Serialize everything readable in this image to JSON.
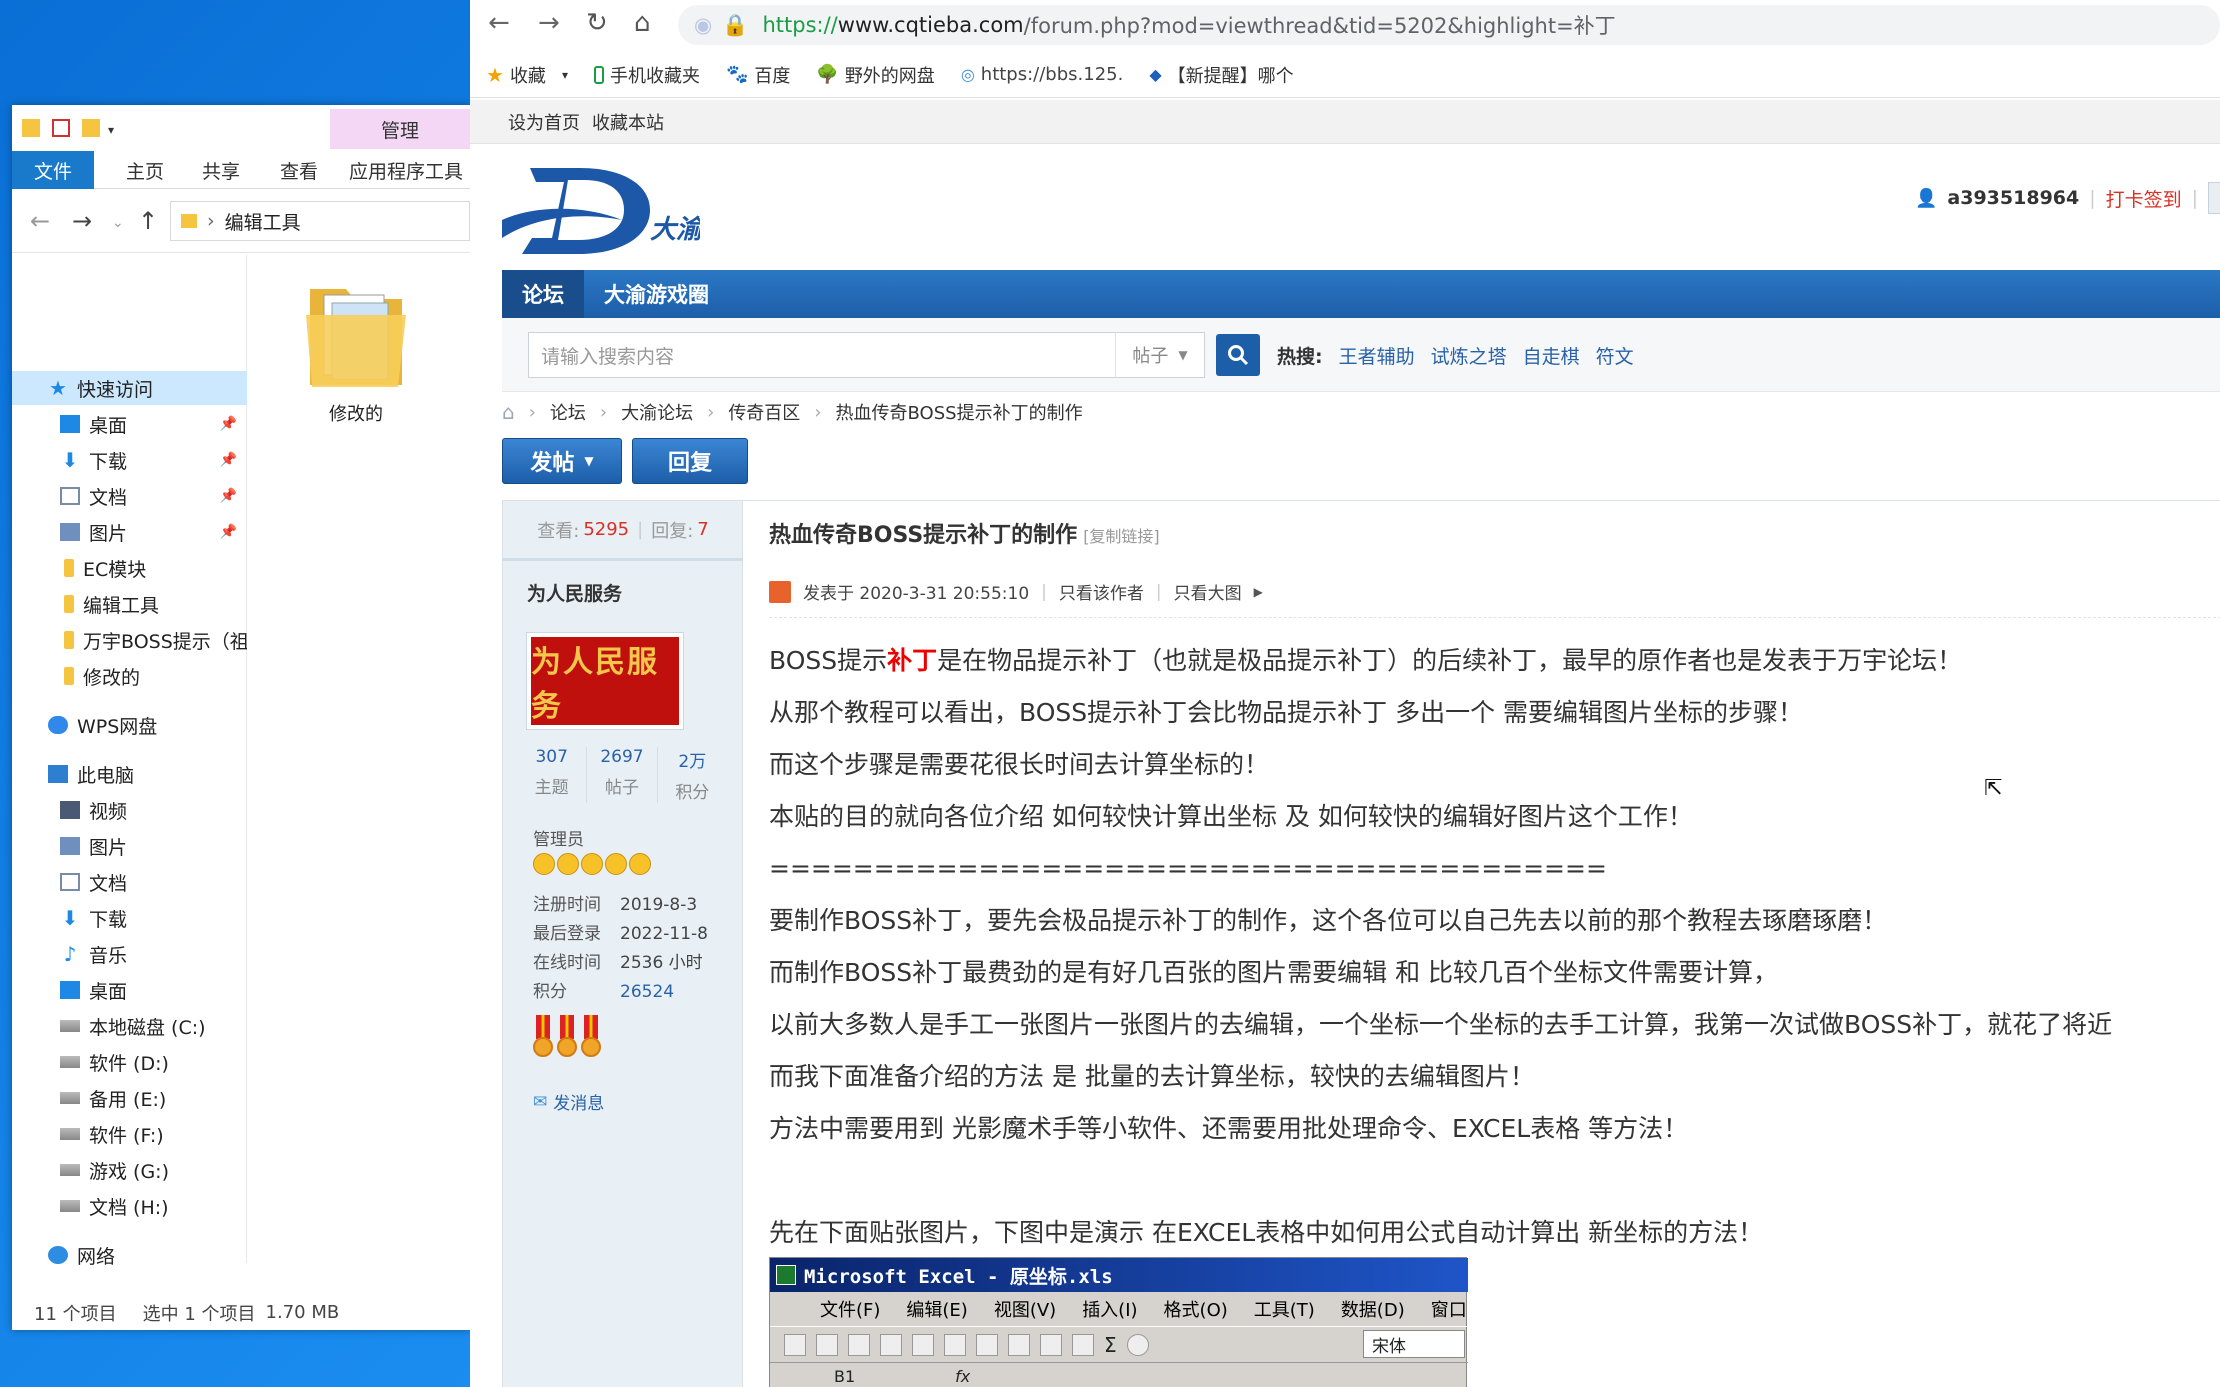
{
  "explorer": {
    "ribbon_context": "管理",
    "tabs": [
      "文件",
      "主页",
      "共享",
      "查看",
      "应用程序工具"
    ],
    "path": "编辑工具",
    "tree": [
      {
        "label": "快速访问",
        "icon": "star-icon"
      },
      {
        "label": "桌面",
        "icon": "desktop-icon",
        "pinned": true
      },
      {
        "label": "下载",
        "icon": "download-icon",
        "pinned": true
      },
      {
        "label": "文档",
        "icon": "document-icon",
        "pinned": true
      },
      {
        "label": "图片",
        "icon": "pictures-icon",
        "pinned": true
      },
      {
        "label": "EC模块",
        "icon": "folder-icon"
      },
      {
        "label": "编辑工具",
        "icon": "folder-icon"
      },
      {
        "label": "万宇BOSS提示（祖",
        "icon": "folder-icon"
      },
      {
        "label": "修改的",
        "icon": "folder-icon"
      },
      {
        "label": "WPS网盘",
        "icon": "cloud-icon"
      },
      {
        "label": "此电脑",
        "icon": "computer-icon"
      },
      {
        "label": "视频",
        "icon": "video-icon"
      },
      {
        "label": "图片",
        "icon": "pictures-icon"
      },
      {
        "label": "文档",
        "icon": "document-icon"
      },
      {
        "label": "下载",
        "icon": "download-icon"
      },
      {
        "label": "音乐",
        "icon": "music-icon"
      },
      {
        "label": "桌面",
        "icon": "desktop-icon"
      },
      {
        "label": "本地磁盘 (C:)",
        "icon": "drive-icon"
      },
      {
        "label": "软件 (D:)",
        "icon": "drive-icon"
      },
      {
        "label": "备用 (E:)",
        "icon": "drive-icon"
      },
      {
        "label": "软件 (F:)",
        "icon": "drive-icon"
      },
      {
        "label": "游戏 (G:)",
        "icon": "drive-icon"
      },
      {
        "label": "文档 (H:)",
        "icon": "drive-icon"
      },
      {
        "label": "网络",
        "icon": "network-icon"
      }
    ],
    "folder_item": "修改的",
    "status": {
      "count": "11 个项目",
      "selected": "选中 1 个项目",
      "size": "1.70 MB"
    }
  },
  "browser": {
    "url_scheme": "https://",
    "url_host": "www.cqtieba.com",
    "url_path": "/forum.php?mod=viewthread&tid=5202&highlight=补丁",
    "bookmarks": [
      {
        "label": "收藏",
        "icon": "star-icon",
        "color": "#f4a300"
      },
      {
        "label": "手机收藏夹",
        "icon": "phone-icon",
        "color": "#1a9c46"
      },
      {
        "label": "百度",
        "icon": "baidu-icon",
        "color": "#2932e1"
      },
      {
        "label": "野外的网盘",
        "icon": "tree-icon",
        "color": "#2e8b2e"
      },
      {
        "label": "https://bbs.125.",
        "icon": "eye-icon",
        "color": "#3a8fd8"
      },
      {
        "label": "【新提醒】哪个",
        "icon": "bird-icon",
        "color": "#1e5fbf"
      }
    ]
  },
  "site": {
    "topbar": [
      "设为首页",
      "收藏本站"
    ],
    "logo_text": "大渝",
    "username": "a393518964",
    "checkin": "打卡签到",
    "nav": [
      "论坛",
      "大渝游戏圈"
    ],
    "search_placeholder": "请输入搜索内容",
    "search_type": "帖子",
    "hot_label": "热搜:",
    "hot": [
      "王者辅助",
      "试炼之塔",
      "自走棋",
      "符文"
    ],
    "breadcrumbs": [
      "论坛",
      "大渝论坛",
      "传奇百区",
      "热血传奇BOSS提示补丁的制作"
    ],
    "post_button": "发帖",
    "reply_button": "回复"
  },
  "thread": {
    "views_label": "查看:",
    "views": "5295",
    "replies_label": "回复:",
    "replies": "7",
    "title": "热血传奇BOSS提示补丁的制作",
    "copy_link": "[复制链接]",
    "author": "为人民服务",
    "avatar_text": "为人民服务",
    "user_stats": [
      {
        "value": "307",
        "label": "主题"
      },
      {
        "value": "2697",
        "label": "帖子"
      },
      {
        "value": "2万",
        "label": "积分"
      }
    ],
    "role": "管理员",
    "info": [
      {
        "key": "注册时间",
        "value": "2019-8-3"
      },
      {
        "key": "最后登录",
        "value": "2022-11-8"
      },
      {
        "key": "在线时间",
        "value": "2536 小时"
      },
      {
        "key": "积分",
        "value": "26524"
      }
    ],
    "send_message": "发消息",
    "posted": "发表于 2020-3-31 20:55:10",
    "only_author": "只看该作者",
    "only_images": "只看大图",
    "post_lines": [
      "从那个教程可以看出，BOSS提示补丁会比物品提示补丁 多出一个 需要编辑图片坐标的步骤！",
      "而这个步骤是需要花很长时间去计算坐标的！",
      "本贴的目的就向各位介绍 如何较快计算出坐标 及 如何较快的编辑好图片这个工作！",
      "========================================",
      "要制作BOSS补丁，要先会极品提示补丁的制作，这个各位可以自己先去以前的那个教程去琢磨琢磨！",
      "而制作BOSS补丁最费劲的是有好几百张的图片需要编辑 和 比较几百个坐标文件需要计算，",
      "以前大多数人是手工一张图片一张图片的去编辑，一个坐标一个坐标的去手工计算，我第一次试做BOSS补丁，就花了将近",
      "而我下面准备介绍的方法 是 批量的去计算坐标，较快的去编辑图片！",
      "方法中需要用到 光影魔术手等小软件、还需要用批处理命令、EXCEL表格 等方法！",
      "",
      "先在下面贴张图片，下图中是演示 在EXCEL表格中如何用公式自动计算出 新坐标的方法！"
    ],
    "first_line_pre": "BOSS提示",
    "first_line_highlight": "补丁",
    "first_line_post": "是在物品提示补丁（也就是极品提示补丁）的后续补丁，最早的原作者也是发表于万宇论坛！"
  },
  "excel": {
    "title": "Microsoft Excel - 原坐标.xls",
    "menu": [
      "文件(F)",
      "编辑(E)",
      "视图(V)",
      "插入(I)",
      "格式(O)",
      "工具(T)",
      "数据(D)",
      "窗口"
    ],
    "font": "宋体",
    "cell": "B1",
    "fx": "fx"
  },
  "colors": {
    "nav_blue": "#1d5ea9",
    "link_blue": "#2a62a8",
    "highlight_red": "#e00000",
    "desktop_blue": "#1c8ff2"
  }
}
